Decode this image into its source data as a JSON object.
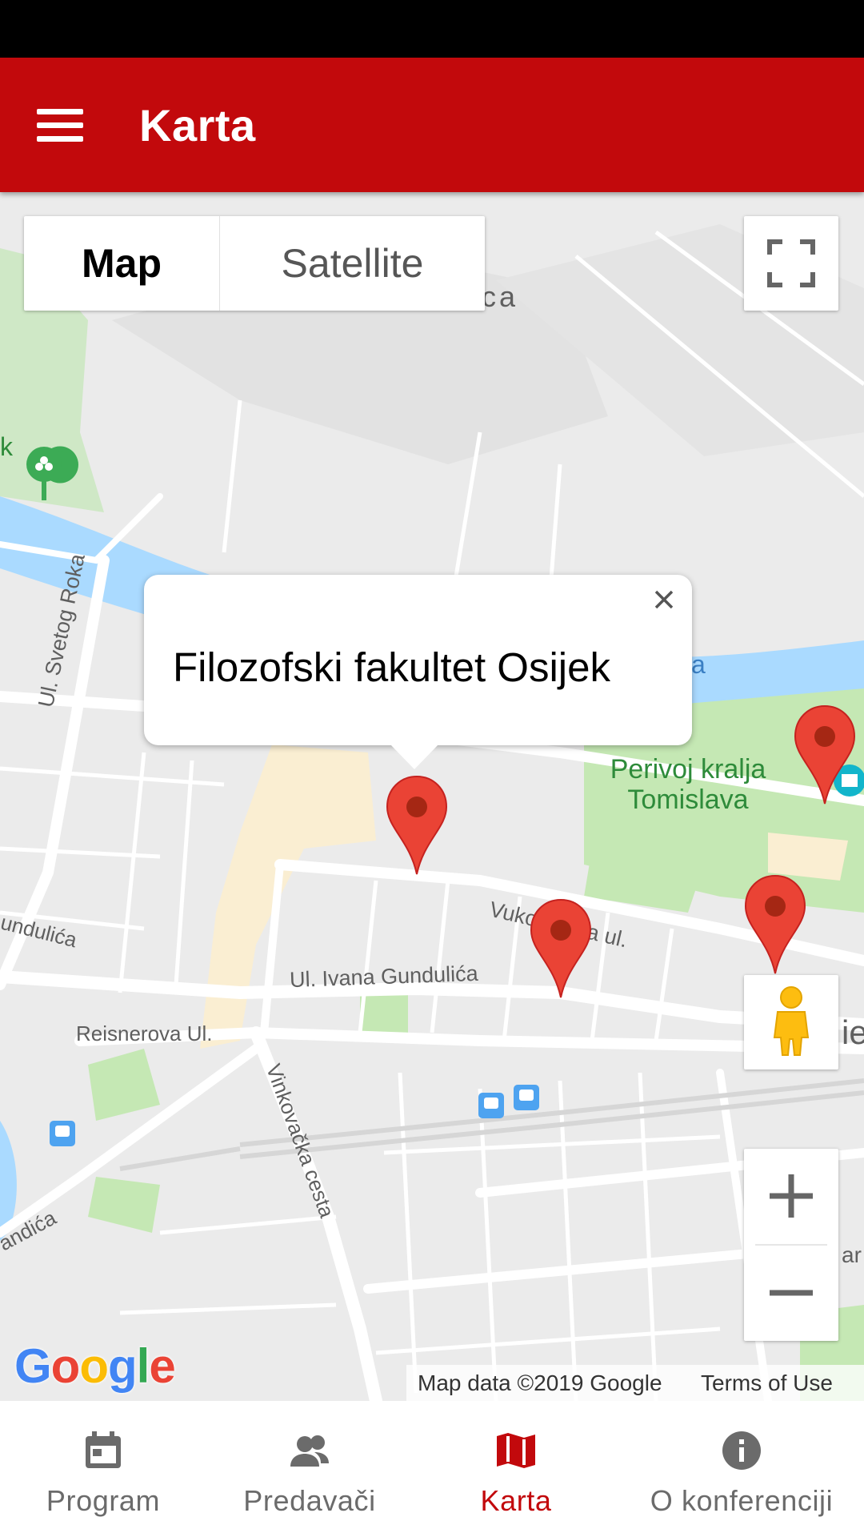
{
  "app_bar": {
    "title": "Karta",
    "color": "#c2090c"
  },
  "map": {
    "type_control": {
      "map_label": "Map",
      "satellite_label": "Satellite",
      "selected": "Map"
    },
    "labels": {
      "svetog_roka": "Ul. Svetog Roka",
      "gundulica_left": "undulića",
      "gundulica": "Ul. Ivana Gundulića",
      "vukovarska": "Vukovarska ul.",
      "reisnerova": "Reisnerova Ul.",
      "vinkovacka": "Vinkovačka cesta",
      "andica": "andića",
      "park": "Perivoj kralja Tomislava",
      "edge_k": "k",
      "edge_ca": "ca",
      "edge_a": "a",
      "edge_ie": "ie",
      "edge_ar": "ar"
    },
    "info_window": {
      "title": "Filozofski fakultet Osijek"
    },
    "markers": [
      "Filozofski fakultet Osijek",
      "marker-2",
      "marker-3",
      "marker-4"
    ],
    "google_logo": [
      "G",
      "o",
      "o",
      "g",
      "l",
      "e"
    ],
    "attribution": {
      "data": "Map data ©2019 Google",
      "terms": "Terms of Use"
    }
  },
  "bottom_nav": {
    "items": [
      {
        "label": "Program",
        "icon": "calendar-icon",
        "active": false
      },
      {
        "label": "Predavači",
        "icon": "people-icon",
        "active": false
      },
      {
        "label": "Karta",
        "icon": "map-icon",
        "active": true
      },
      {
        "label": "O konferenciji",
        "icon": "info-icon",
        "active": false
      }
    ]
  }
}
